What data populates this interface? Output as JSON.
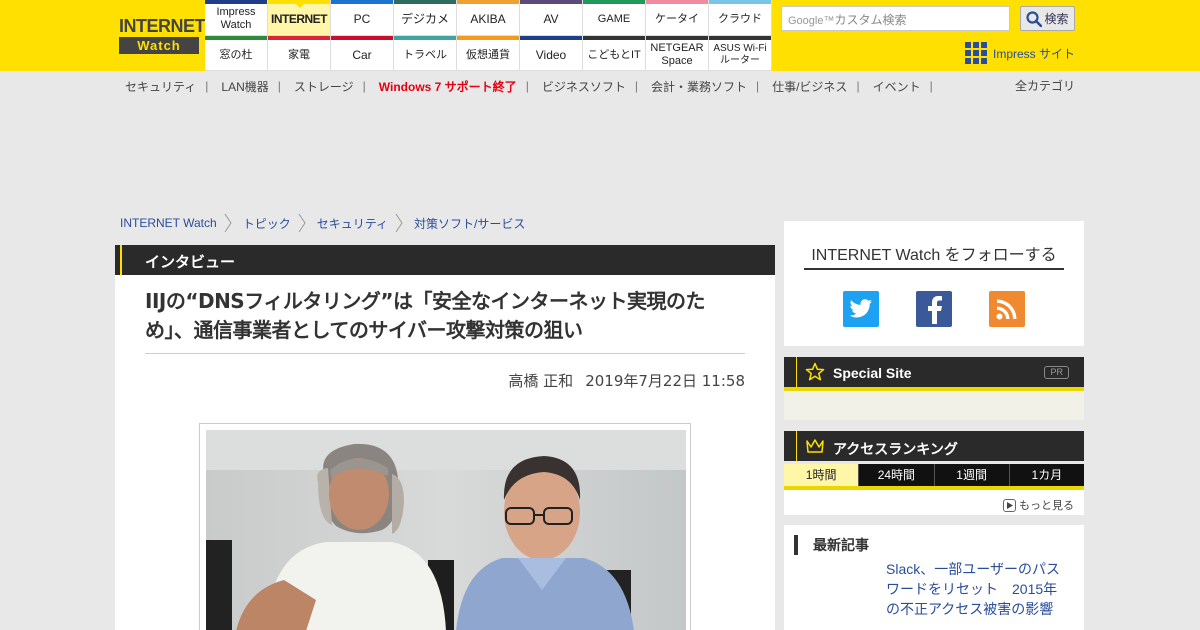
{
  "site": {
    "logo_line1": "INTERNET",
    "logo_line2": "Watch",
    "brand_yellow": "#ffe000"
  },
  "nav": {
    "row1": [
      {
        "label": "Impress Watch",
        "color": "#1f3d8a"
      },
      {
        "label": "INTERNET",
        "color": "#ffe000",
        "active": true
      },
      {
        "label": "PC",
        "color": "#1a74d0"
      },
      {
        "label": "デジカメ",
        "color": "#2f6b5e"
      },
      {
        "label": "AKIBA",
        "color": "#f0a030"
      },
      {
        "label": "AV",
        "color": "#5b4a7a"
      },
      {
        "label": "GAME",
        "color": "#1f9a5a"
      },
      {
        "label": "ケータイ",
        "color": "#f08aa0"
      },
      {
        "label": "クラウド",
        "color": "#7ac4e8"
      }
    ],
    "row2": [
      {
        "label": "窓の杜",
        "color": "#2e8b3e"
      },
      {
        "label": "家電",
        "color": "#d8253a"
      },
      {
        "label": "Car",
        "color": "#c8102e"
      },
      {
        "label": "トラベル",
        "color": "#3fa4a0"
      },
      {
        "label": "仮想通貨",
        "color": "#f09a20"
      },
      {
        "label": "Video",
        "color": "#1f3d8a"
      },
      {
        "label": "こどもとIT",
        "color": "#333333"
      },
      {
        "label": "NETGEAR Space",
        "color": "#333333"
      },
      {
        "label": "ASUS Wi-Fiルーター",
        "color": "#333333"
      }
    ]
  },
  "search": {
    "google_label": "Google™",
    "placeholder": "カスタム検索",
    "button_label": "検索"
  },
  "impress_link": "Impress サイト",
  "categories": [
    {
      "label": "セキュリティ"
    },
    {
      "label": "LAN機器"
    },
    {
      "label": "ストレージ"
    },
    {
      "label": "Windows 7 サポート終了",
      "highlight": true
    },
    {
      "label": "ビジネスソフト"
    },
    {
      "label": "会計・業務ソフト"
    },
    {
      "label": "仕事/ビジネス"
    },
    {
      "label": "イベント"
    }
  ],
  "all_categories": "全カテゴリ",
  "breadcrumb": [
    "INTERNET Watch",
    "トピック",
    "セキュリティ",
    "対策ソフト/サービス"
  ],
  "article": {
    "section": "インタビュー",
    "title": "IIJの“DNSフィルタリング”は「安全なインターネット実現のため」、通信事業者としてのサイバー攻撃対策の狙い",
    "author": "高橋 正和",
    "date": "2019年7月22日 11:58"
  },
  "sidebar": {
    "follow_title": "INTERNET Watch をフォローする",
    "special_title": "Special Site",
    "special_pr": "PR",
    "ranking_title": "アクセスランキング",
    "ranking_tabs": [
      "1時間",
      "24時間",
      "1週間",
      "1カ月"
    ],
    "more_label": "もっと見る",
    "latest_title": "最新記事",
    "latest_item": "Slack、一部ユーザーのパスワードをリセット　2015年の不正アクセス被害の影響"
  },
  "icons": {
    "search": "search-icon",
    "impress_grid": "grid-icon",
    "twitter": "twitter-icon",
    "facebook": "facebook-icon",
    "rss": "rss-icon",
    "star": "star-icon",
    "crown": "crown-icon",
    "play": "play-icon"
  }
}
